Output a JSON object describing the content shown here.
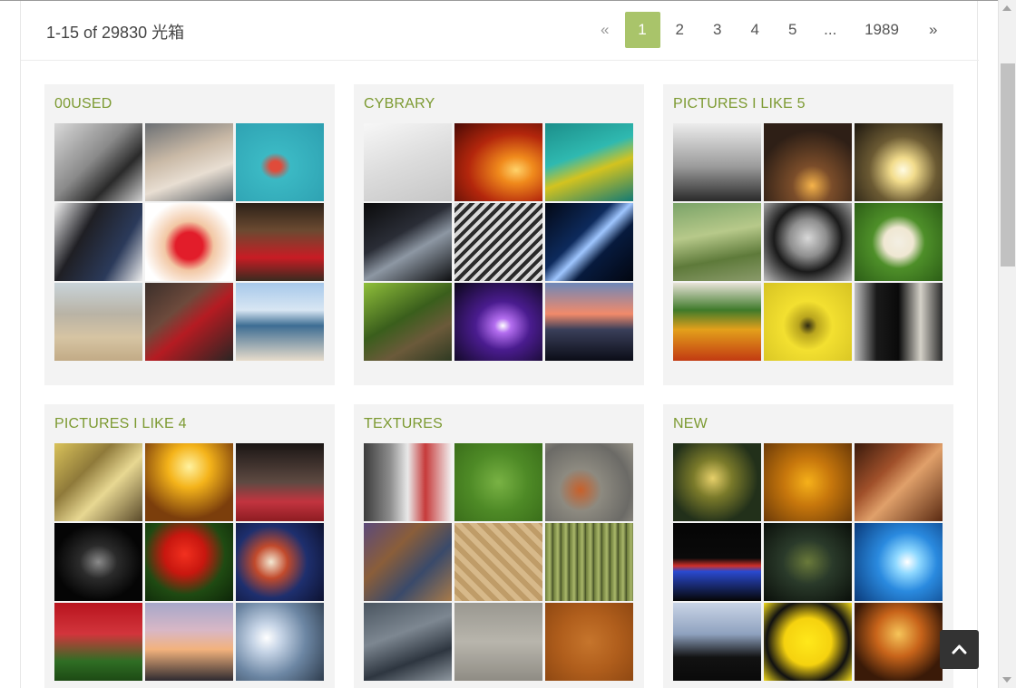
{
  "header": {
    "count_text": "1-15 of 29830 光箱"
  },
  "pagination": {
    "prev": "«",
    "pages": [
      "1",
      "2",
      "3",
      "4",
      "5",
      "...",
      "1989"
    ],
    "active": "1",
    "next": "»"
  },
  "collections": [
    {
      "title": "00USED",
      "thumbs": [
        "linear-gradient(135deg,#d9d9d9 0%,#8a8a8a 45%,#2a2a2a 70%,#cfcfcf 100%)",
        "linear-gradient(160deg,#6b6f73 0%,#c9b9a6 40%,#e8ded2 65%,#5c6166 100%)",
        "radial-gradient(ellipse at 45% 55%,#e04b3a 0%,#e04b3a 8%,#3bb9c4 22%,#2d9fb0 100%)",
        "linear-gradient(120deg,#f2f2f2 0%,#1f1f24 35%,#2b3a5a 70%,#eeeeee 100%)",
        "radial-gradient(circle at 50% 55%,#e21d2a 0%,#e21d2a 22%,#f2c7a4 40%,#ffffff 75%)",
        "linear-gradient(180deg,#2c2118 0%,#6b4a31 35%,#c81c24 70%,#3a2a1f 100%)",
        "linear-gradient(180deg,#c8d3d9 0%,#b9b3a5 40%,#d6c4a3 70%,#c2ab86 100%)",
        "linear-gradient(140deg,#3b2f2a 0%,#6d4a3c 35%,#b51b22 55%,#2a2523 100%)",
        "linear-gradient(180deg,#a7c8ea 0%,#d8e6f3 35%,#3d6d93 55%,#e7dccb 100%)"
      ]
    },
    {
      "title": "CYBRARY",
      "thumbs": [
        "linear-gradient(160deg,#f7f7f7 0%,#dcdcdc 50%,#c6c6c6 100%)",
        "radial-gradient(ellipse at 70% 60%,#ffd36b 0%,#f08a1c 20%,#b3260c 55%,#4a0a05 100%)",
        "linear-gradient(160deg,#1c8e8a 0%,#2fb9b0 40%,#d3c31f 60%,#127a75 100%)",
        "linear-gradient(150deg,#0b0b0c 0%,#2a2d36 40%,#8d97a3 60%,#0d0e10 100%)",
        "repeating-linear-gradient(135deg,#d9d9d9 0px,#d9d9d9 4px,#2b2b2b 4px,#2b2b2b 8px)",
        "linear-gradient(135deg,#030814 0%,#0d2a5c 40%,#9fc6ff 52%,#071a3d 65%,#020610 100%)",
        "linear-gradient(150deg,#8fbf3a 0%,#3a5e1c 45%,#6b5a3a 70%,#2f3a22 100%)",
        "radial-gradient(ellipse at 55% 55%,#ffffff 0%,#b46ef0 12%,#4a1c8f 40%,#0a0618 100%)",
        "linear-gradient(180deg,#6d87b8 0%,#f28a6a 40%,#3a3f5a 60%,#0b0d17 100%)"
      ]
    },
    {
      "title": "PICTURES I LIKE 5",
      "thumbs": [
        "linear-gradient(180deg,#ececec 0%,#9c9c9c 55%,#2a2a2a 100%)",
        "radial-gradient(circle at 55% 80%,#f6b34a 0%,#7b4d2a 25%,#2e1f16 70%)",
        "radial-gradient(circle at 55% 60%,#fffbe2 0%,#f2dc8c 18%,#6b5a33 50%,#1d170f 100%)",
        "linear-gradient(170deg,#7aa368 0%,#b7c98a 40%,#5e7a3a 70%,#8a9a6a 100%)",
        "radial-gradient(circle at 50% 45%,#d8d8d8 0%,#8e8e8e 30%,#1a1a1a 55%,#bdbdbd 100%)",
        "radial-gradient(circle at 50% 50%,#f3efe3 0%,#efe7d2 25%,#4e8f29 45%,#2c5e16 100%)",
        "linear-gradient(180deg,#e8e3d8 0%,#3f7a2a 35%,#e3a01b 60%,#c23a12 100%)",
        "radial-gradient(circle at 50% 55%,#2f2a12 0%,#b9a51e 15%,#f3e030 40%,#d6c323 100%)",
        "linear-gradient(90deg,#bfbfbf 0%,#1a1a1a 25%,#0a0a0a 50%,#d4d1c8 75%,#2a2a2a 100%)"
      ]
    },
    {
      "title": "PICTURES I LIKE 4",
      "thumbs": [
        "linear-gradient(135deg,#d9c25a 0%,#8f7a3a 35%,#e8d892 60%,#5a4a2a 100%)",
        "radial-gradient(circle at 50% 30%,#fff2a0 0%,#f4b31a 30%,#7b3e0c 75%)",
        "linear-gradient(180deg,#1a1514 0%,#5e4a42 50%,#c2343f 75%,#8e1c22 100%)",
        "radial-gradient(ellipse at 50% 50%,#8a8a8a 0%,#2b2b2b 30%,#050505 70%)",
        "radial-gradient(circle at 45% 40%,#f2301f 0%,#c8170f 30%,#1f4a12 60%,#0d2508 100%)",
        "radial-gradient(circle at 40% 50%,#f3e8d2 0%,#c14a2c 25%,#1e2f6e 55%,#0d1230 100%)",
        "linear-gradient(180deg,#b8141e 0%,#d2353c 40%,#2f6e24 75%,#1d4a14 100%)",
        "linear-gradient(180deg,#a6a7c9 0%,#d8b7c6 35%,#f2b27c 60%,#2f2a30 100%)",
        "radial-gradient(circle at 35% 45%,#ffffff 0%,#c6d4e6 20%,#6c86a3 55%,#2e3c4d 100%)"
      ]
    },
    {
      "title": "TEXTURES",
      "thumbs": [
        "linear-gradient(90deg,#3c3c3c 0%,#8d8d8d 30%,#e9e9e9 50%,#c63a3a 70%,#f2f2f2 100%)",
        "radial-gradient(circle at 50% 50%,#79b244 0%,#4e8a26 50%,#3a6e1a 100%)",
        "radial-gradient(circle at 40% 60%,#c8602a 0%,#8d8a80 30%,#6b6a66 70%,#9a968b 100%)",
        "linear-gradient(135deg,#5c4a7a 0%,#8a5e3a 35%,#3a4a6a 65%,#a87a4a 100%)",
        "repeating-linear-gradient(45deg,#d7b98a 0px,#d7b98a 6px,#bf9c68 6px,#bf9c68 12px)",
        "repeating-linear-gradient(90deg,#6b7a3a 0px,#aab86a 5px,#3e4a22 9px)",
        "linear-gradient(160deg,#4a5560 0%,#7d8791 40%,#2e3640 70%,#8e979f 100%)",
        "linear-gradient(180deg,#9a9890 0%,#b8b5ac 50%,#8f8c84 100%)",
        "radial-gradient(circle at 50% 50%,#c6752c 0%,#b05e1c 50%,#8f4812 100%)"
      ]
    },
    {
      "title": "NEW",
      "thumbs": [
        "radial-gradient(circle at 45% 45%,#e7d06a 0%,#7a7a2a 30%,#22301a 70%)",
        "radial-gradient(circle at 50% 50%,#f6b11a 0%,#c7770c 40%,#6b3a08 100%)",
        "linear-gradient(135deg,#3a1a0c 0%,#a0502a 35%,#e0a06a 55%,#5a2a12 100%)",
        "linear-gradient(180deg,#050505 0%,#0a0a0a 45%,#d0302a 55%,#2a4ad0 62%,#050505 100%)",
        "radial-gradient(ellipse at 50% 50%,#6a7a3a 0%,#2a3a2a 40%,#0a0f0a 100%)",
        "radial-gradient(circle at 60% 50%,#ffffff 0%,#8ed8ff 18%,#2a8adf 45%,#0a3a7a 100%)",
        "linear-gradient(180deg,#c9d4e6 0%,#8fa2bf 40%,#121212 70%,#0a0a0a 100%)",
        "radial-gradient(circle at 50% 50%,#ffe81a 0%,#f5d20f 40%,#111111 70%,#f2da1a 100%)",
        "radial-gradient(circle at 50% 40%,#f6c55a 0%,#c8641a 35%,#3a1a08 75%)"
      ]
    }
  ],
  "icons": {
    "back_to_top": "chevron-up-icon"
  },
  "colors": {
    "accent": "#a9c46a",
    "title_green": "#7c9a31",
    "card_bg": "#f3f3f3"
  }
}
